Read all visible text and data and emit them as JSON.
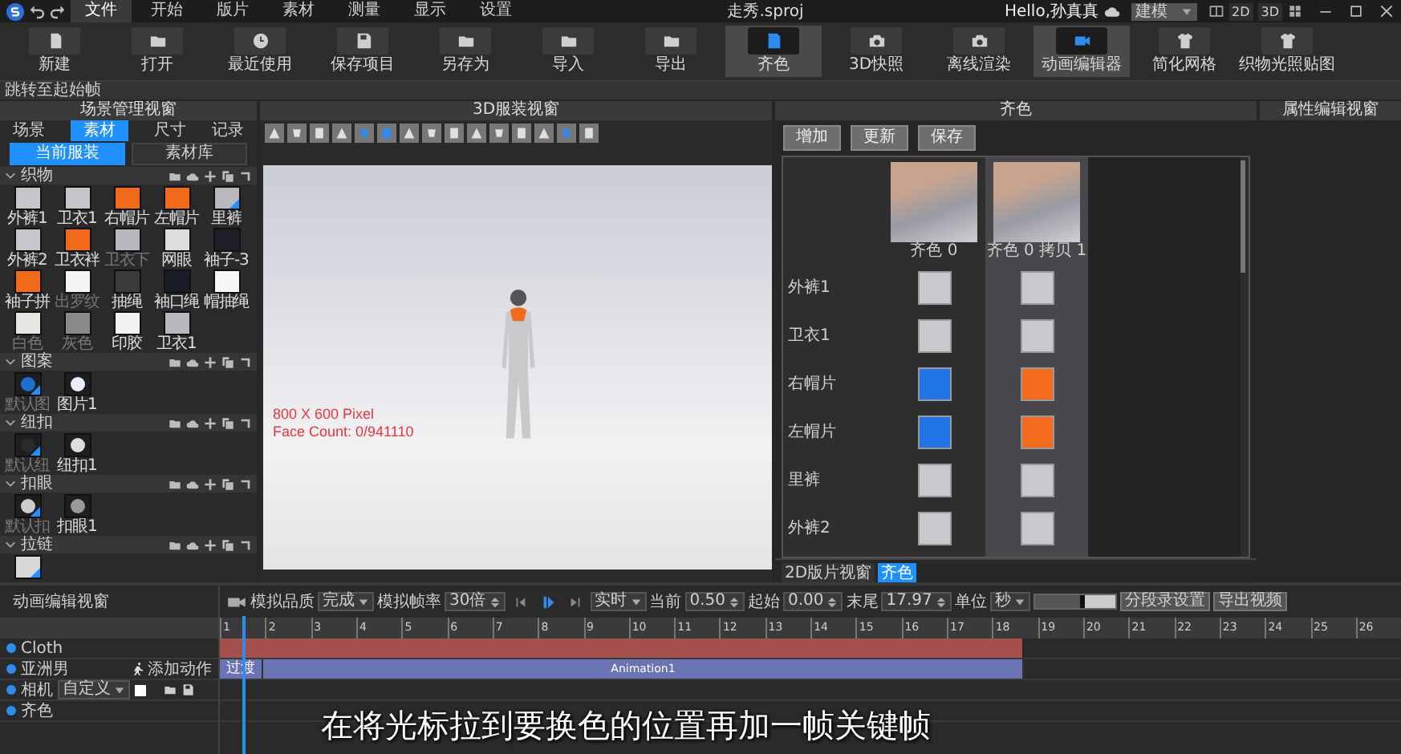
{
  "title_bar": {
    "menu_tabs": [
      {
        "label": "文件",
        "selected": true
      },
      {
        "label": "开始",
        "selected": false
      },
      {
        "label": "版片",
        "selected": false
      },
      {
        "label": "素材",
        "selected": false
      },
      {
        "label": "测量",
        "selected": false
      },
      {
        "label": "显示",
        "selected": false
      },
      {
        "label": "设置",
        "selected": false
      }
    ],
    "file_name": "走秀.sproj",
    "user": "Hello,孙真真",
    "mode": "建模",
    "view_buttons": [
      "2D",
      "3D"
    ]
  },
  "toolbar": [
    {
      "label": "新建",
      "selected": false
    },
    {
      "label": "打开",
      "selected": false
    },
    {
      "label": "最近使用",
      "selected": false
    },
    {
      "label": "保存项目",
      "selected": false
    },
    {
      "label": "另存为",
      "selected": false
    },
    {
      "label": "导入",
      "selected": false
    },
    {
      "label": "导出",
      "selected": false
    },
    {
      "label": "齐色",
      "selected": true
    },
    {
      "label": "3D快照",
      "selected": false
    },
    {
      "label": "离线渲染",
      "selected": false
    },
    {
      "label": "动画编辑器",
      "selected": true
    },
    {
      "label": "简化网格",
      "selected": false
    },
    {
      "label": "织物光照贴图",
      "selected": false
    }
  ],
  "status": "跳转至起始帧",
  "scene_panel": {
    "title": "场景管理视窗",
    "tabs": [
      {
        "label": "场景",
        "selected": false
      },
      {
        "label": "素材",
        "selected": true
      },
      {
        "label": "尺寸",
        "selected": false
      },
      {
        "label": "记录",
        "selected": false
      }
    ],
    "subtabs": [
      {
        "label": "当前服装",
        "selected": true
      },
      {
        "label": "素材库",
        "selected": false
      }
    ],
    "sections": [
      {
        "title": "织物",
        "items": [
          {
            "label": "外裤1",
            "kind": "fabric",
            "color": "#c5c6cb",
            "disabled": false,
            "corner_mark": false
          },
          {
            "label": "卫衣1",
            "kind": "fabric",
            "color": "#c5c6cb",
            "disabled": false,
            "corner_mark": false
          },
          {
            "label": "右帽片",
            "kind": "fabric",
            "color": "#f06a1a",
            "disabled": false,
            "corner_mark": false
          },
          {
            "label": "左帽片",
            "kind": "fabric",
            "color": "#f06a1a",
            "disabled": false,
            "corner_mark": false
          },
          {
            "label": "里裤",
            "kind": "fabric",
            "color": "#b8b9be",
            "disabled": false,
            "corner_mark": true
          },
          {
            "label": "外裤2",
            "kind": "fabric",
            "color": "#c5c6cb",
            "disabled": false,
            "corner_mark": false
          },
          {
            "label": "卫衣袢",
            "kind": "fabric",
            "color": "#f06a1a",
            "disabled": false,
            "corner_mark": false
          },
          {
            "label": "卫衣下",
            "kind": "fabric",
            "color": "#b8b9be",
            "disabled": true,
            "corner_mark": false
          },
          {
            "label": "网眼",
            "kind": "fabric",
            "color": "#dcdcdc",
            "disabled": false,
            "corner_mark": false
          },
          {
            "label": "袖子-3",
            "kind": "fabric",
            "color": "#1c1d26",
            "disabled": false,
            "corner_mark": false
          },
          {
            "label": "袖子拼",
            "kind": "fabric",
            "color": "#f06a1a",
            "disabled": false,
            "corner_mark": false
          },
          {
            "label": "出罗纹",
            "kind": "fabric",
            "color": "#f4f4f4",
            "disabled": true,
            "corner_mark": false
          },
          {
            "label": "抽绳",
            "kind": "fabric",
            "color": "#3a3c3a",
            "disabled": false,
            "corner_mark": false
          },
          {
            "label": "袖口绳",
            "kind": "fabric",
            "color": "#1a1c28",
            "disabled": false,
            "corner_mark": false
          },
          {
            "label": "帽抽绳",
            "kind": "fabric",
            "color": "#f6f6f6",
            "disabled": false,
            "corner_mark": false
          },
          {
            "label": "白色",
            "kind": "fabric",
            "color": "#e8e6e0",
            "disabled": true,
            "corner_mark": false
          },
          {
            "label": "灰色",
            "kind": "fabric",
            "color": "#8a8a8a",
            "disabled": true,
            "corner_mark": false
          },
          {
            "label": "印胶",
            "kind": "fabric",
            "color": "#f2f2f2",
            "disabled": false,
            "corner_mark": false
          },
          {
            "label": "卫衣1",
            "kind": "fabric",
            "color": "#b8b9be",
            "disabled": false,
            "corner_mark": false
          }
        ]
      },
      {
        "title": "图案",
        "items": [
          {
            "label": "默认图",
            "kind": "graphic",
            "color": "#1e6fd0",
            "disabled": true,
            "corner_mark": true
          },
          {
            "label": "图片1",
            "kind": "graphic",
            "color": "#e8eef8",
            "disabled": false,
            "corner_mark": false
          }
        ]
      },
      {
        "title": "纽扣",
        "items": [
          {
            "label": "默认纽",
            "kind": "graphic",
            "color": "#2a2a2a",
            "disabled": true,
            "corner_mark": true
          },
          {
            "label": "纽扣1",
            "kind": "graphic",
            "color": "#dddddd",
            "disabled": false,
            "corner_mark": false
          }
        ]
      },
      {
        "title": "扣眼",
        "items": [
          {
            "label": "默认扣",
            "kind": "graphic",
            "color": "#cccccc",
            "disabled": true,
            "corner_mark": true
          },
          {
            "label": "扣眼1",
            "kind": "graphic",
            "color": "#9a9a9a",
            "disabled": false,
            "corner_mark": false
          }
        ]
      },
      {
        "title": "拉链",
        "items": [
          {
            "kind": "fabric",
            "color": "#d8d8d8",
            "corner_mark": true
          }
        ]
      }
    ]
  },
  "view3d": {
    "title": "3D服装视窗",
    "resolution": "800 X 600 Pixel",
    "face_count": "Face Count: 0/941110"
  },
  "colorway_panel": {
    "title": "齐色",
    "buttons": [
      "增加",
      "更新",
      "保存"
    ],
    "rows": [
      "外裤1",
      "卫衣1",
      "右帽片",
      "左帽片",
      "里裤",
      "外裤2"
    ],
    "columns": [
      {
        "name": "齐色 0",
        "selected": false,
        "swatches": [
          {
            "color": "#c8c9ce"
          },
          {
            "color": "#c8c9ce"
          },
          {
            "color": "#2176e6"
          },
          {
            "color": "#2176e6"
          },
          {
            "color": "#c8c9ce"
          },
          {
            "color": "#c8c9ce"
          }
        ]
      },
      {
        "name": "齐色 0 拷贝 1",
        "selected": true,
        "swatches": [
          {
            "color": "#c8c9ce"
          },
          {
            "color": "#c8c9ce"
          },
          {
            "color": "#f36c1c"
          },
          {
            "color": "#f36c1c"
          },
          {
            "color": "#c8c9ce"
          },
          {
            "color": "#c8c9ce"
          }
        ]
      }
    ],
    "bottom_tabs": [
      {
        "label": "2D版片视窗",
        "selected": false
      },
      {
        "label": "齐色",
        "selected": true
      }
    ]
  },
  "property_panel": {
    "title": "属性编辑视窗"
  },
  "animation": {
    "title": "动画编辑视窗",
    "quality_label": "模拟品质",
    "quality": "完成",
    "fps_label": "模拟帧率",
    "fps": "30倍",
    "speed": "实时",
    "current_label": "当前",
    "current": "0.50",
    "start_label": "起始",
    "start": "0.00",
    "end_label": "末尾",
    "end": "17.97",
    "unit_label": "单位",
    "unit": "秒",
    "zoom": {
      "level": 0.62
    },
    "segment_button": "分段录设置",
    "export_button": "导出视频",
    "ticks": [
      "1",
      "2",
      "3",
      "4",
      "5",
      "6",
      "7",
      "8",
      "9",
      "10",
      "11",
      "12",
      "13",
      "14",
      "15",
      "16",
      "17",
      "18",
      "19",
      "20",
      "21",
      "22",
      "23",
      "24",
      "25",
      "26"
    ],
    "tracks": [
      {
        "name": "Cloth",
        "kind": "bar"
      },
      {
        "name": "亚洲男",
        "kind": "clips",
        "action": "添加动作",
        "clips": [
          "过渡",
          "Animation1"
        ]
      },
      {
        "name": "相机",
        "kind": "camera",
        "select": "自定义"
      },
      {
        "name": "齐色",
        "kind": "empty"
      }
    ]
  },
  "subtitle": "在将光标拉到要换色的位置再加一帧关键帧"
}
